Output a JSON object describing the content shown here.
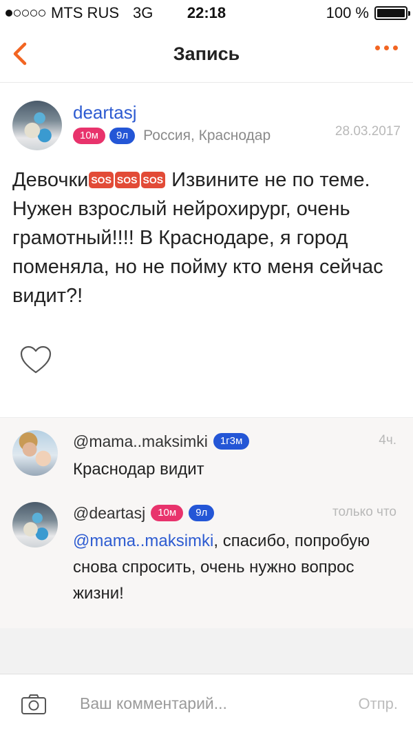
{
  "status_bar": {
    "carrier": "MTS RUS",
    "network": "3G",
    "time": "22:18",
    "battery": "100 %",
    "battery_level": 1.0
  },
  "nav": {
    "title": "Запись",
    "back_icon": "chevron-left-icon",
    "more_icon": "more-dots-icon",
    "accent_color": "#f26522"
  },
  "post": {
    "author": "deartasj",
    "badges": [
      "10м",
      "9л"
    ],
    "location": "Россия, Краснодар",
    "date": "28.03.2017",
    "text_before": "Девочки",
    "sos_label": "SOS",
    "text_after": " Извините не по теме. Нужен взрослый нейрохирург, очень грамотный!!!! В Краснодаре, я город поменяла, но не пойму кто меня сейчас видит?!"
  },
  "comments": [
    {
      "author": "@mama..maksimki",
      "badges": [
        "1г3м"
      ],
      "time": "4ч.",
      "mention": "",
      "text": "Краснодар видит"
    },
    {
      "author": "@deartasj",
      "badges": [
        "10м",
        "9л"
      ],
      "time": "только что",
      "mention": "@mama..maksimki",
      "text": ", спасибо, попробую снова спросить, очень нужно вопрос жизни!"
    }
  ],
  "composer": {
    "placeholder": "Ваш комментарий...",
    "send_label": "Отпр."
  },
  "colors": {
    "link_blue": "#2d5bd1",
    "badge_pink": "#e8336c",
    "badge_blue": "#2456d6"
  }
}
